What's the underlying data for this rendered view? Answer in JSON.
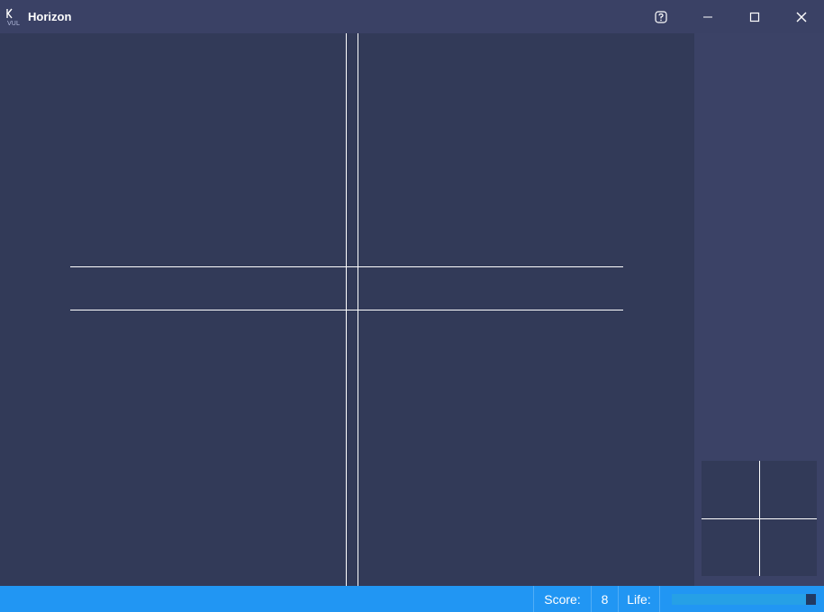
{
  "window": {
    "title": "Horizon",
    "logo_icon": "k-app-logo-icon",
    "controls": [
      "help-icon",
      "minimize-icon",
      "maximize-icon",
      "close-icon"
    ]
  },
  "status": {
    "score_label": "Score:",
    "score_value": "8",
    "life_label": "Life:",
    "life_fraction": 0.93
  },
  "colors": {
    "game_background": "#323a58",
    "side_panel": "#3b4266",
    "titlebar": "#3a4165",
    "statusbar": "#2196f3",
    "lines": "#ffffff"
  }
}
